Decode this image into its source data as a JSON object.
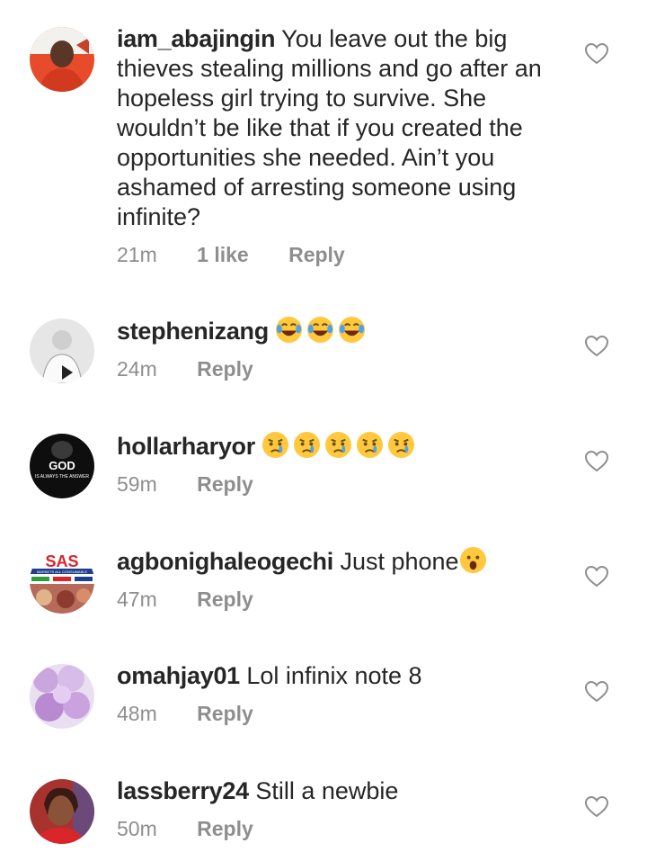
{
  "comments": [
    {
      "username": "iam_abajingin",
      "text": "You leave out the big thieves stealing millions and go after an hopeless girl trying to survive. She wouldn’t be like that if you created the opportunities she needed. Ain’t you ashamed of arresting someone using infinite?",
      "time": "21m",
      "likes": "1 like",
      "reply": "Reply"
    },
    {
      "username": "stephenizang",
      "text": "",
      "emoji": [
        "tears-of-joy",
        "tears-of-joy",
        "tears-of-joy"
      ],
      "time": "24m",
      "reply": "Reply"
    },
    {
      "username": "hollarharyor",
      "text": "",
      "emoji": [
        "crying-face",
        "crying-face",
        "crying-face",
        "crying-face",
        "crying-face"
      ],
      "avatar_text": {
        "line1": "GOD",
        "line2": "IS ALWAYS THE ANSWER"
      },
      "time": "59m",
      "reply": "Reply"
    },
    {
      "username": "agbonighaleogechi",
      "text": "Just phone",
      "emoji": [
        "surprised-face"
      ],
      "avatar_text": {
        "line1": "SAS",
        "line2": "MARKETS ALL CONSUMABLE"
      },
      "time": "47m",
      "reply": "Reply"
    },
    {
      "username": "omahjay01",
      "text": "Lol infinix note 8",
      "time": "48m",
      "reply": "Reply"
    },
    {
      "username": "lassberry24",
      "text": "Still a newbie",
      "time": "50m",
      "reply": "Reply"
    }
  ],
  "colors": {
    "text": "#262626",
    "meta": "#8e8e8e",
    "heart": "#8e8e8e"
  }
}
